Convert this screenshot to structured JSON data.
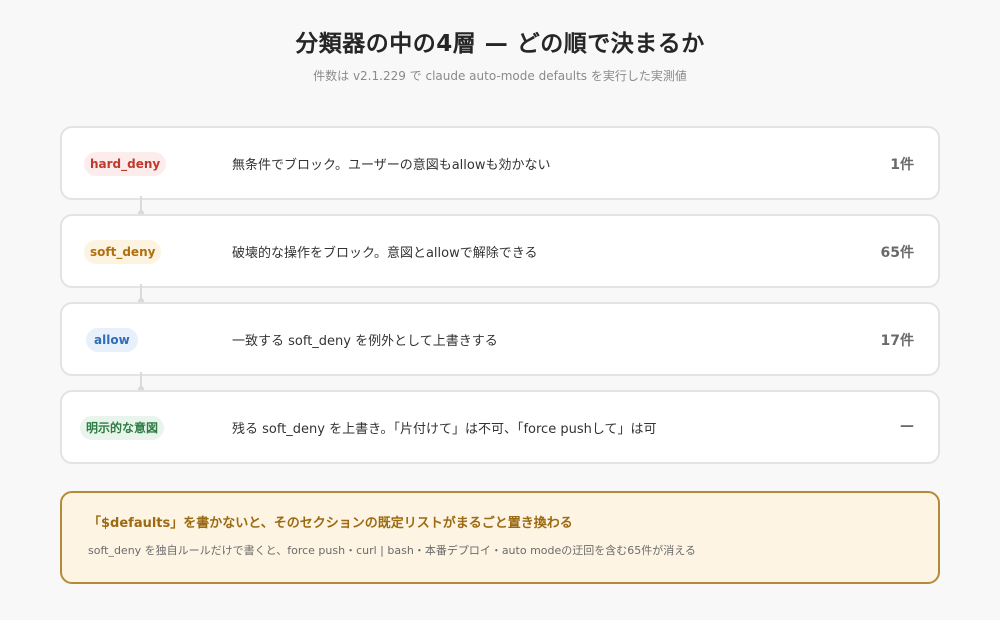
{
  "header": {
    "title": "分類器の中の4層 — どの順で決まるか",
    "subtitle": "件数は v2.1.229 で claude auto-mode defaults を実行した実測値"
  },
  "layers": [
    {
      "badge": "hard_deny",
      "description": "無条件でブロック。ユーザーの意図もallowも効かない",
      "count": "1件",
      "color": "#c0392b"
    },
    {
      "badge": "soft_deny",
      "description": "破壊的な操作をブロック。意図とallowで解除できる",
      "count": "65件",
      "color": "#b06f0f"
    },
    {
      "badge": "allow",
      "description": "一致する soft_deny を例外として上書きする",
      "count": "17件",
      "color": "#2f6db5"
    },
    {
      "badge": "明示的な意図",
      "description": "残る soft_deny を上書き。「片付けて」は不可、「force pushして」は可",
      "count": "—",
      "color": "#2e7d43"
    }
  ],
  "callout": {
    "title": "「$defaults」を書かないと、そのセクションの既定リストがまるごと置き換わる",
    "body": "soft_deny を独自ルールだけで書くと、force push・curl | bash・本番デプロイ・auto modeの迂回を含む65件が消える",
    "border_color": "#b58a36",
    "background": "#fdf4e3"
  }
}
